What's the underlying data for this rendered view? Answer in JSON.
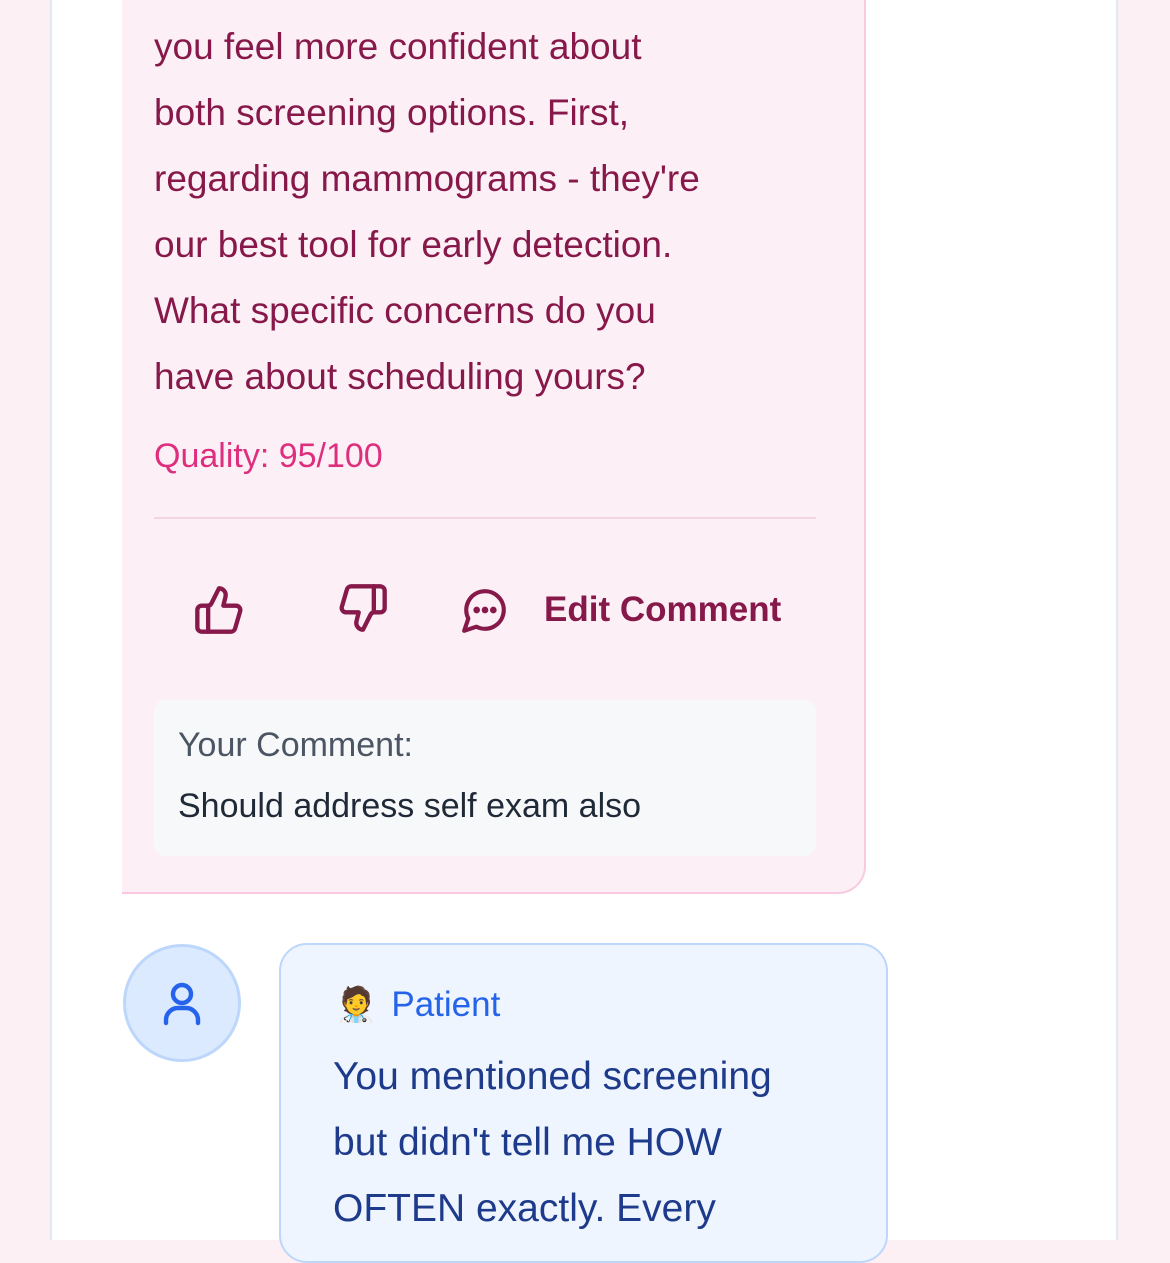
{
  "ai_message": {
    "lines": [
      "you feel more confident about",
      "both screening options. First,",
      "regarding mammograms - they're",
      "our best tool for early detection.",
      "What specific concerns do you",
      "have about scheduling yours?"
    ],
    "quality": "Quality: 95/100",
    "actions": {
      "thumbs_up_icon": "thumbs-up-icon",
      "thumbs_down_icon": "thumbs-down-icon",
      "comment_icon": "chat-bubble-icon",
      "edit_comment_label": "Edit Comment"
    },
    "comment": {
      "heading": "Your Comment:",
      "text": "Should address self exam also"
    }
  },
  "patient_message": {
    "avatar_icon": "user-icon",
    "emoji": "🧑‍⚕️",
    "sender": "Patient",
    "lines": [
      "You mentioned screening",
      "but didn't tell me HOW",
      "OFTEN exactly. Every"
    ]
  },
  "colors": {
    "ai_text": "#86184a",
    "quality": "#de2f7f",
    "patient_accent": "#2563eb",
    "patient_text": "#1e3a8a"
  }
}
